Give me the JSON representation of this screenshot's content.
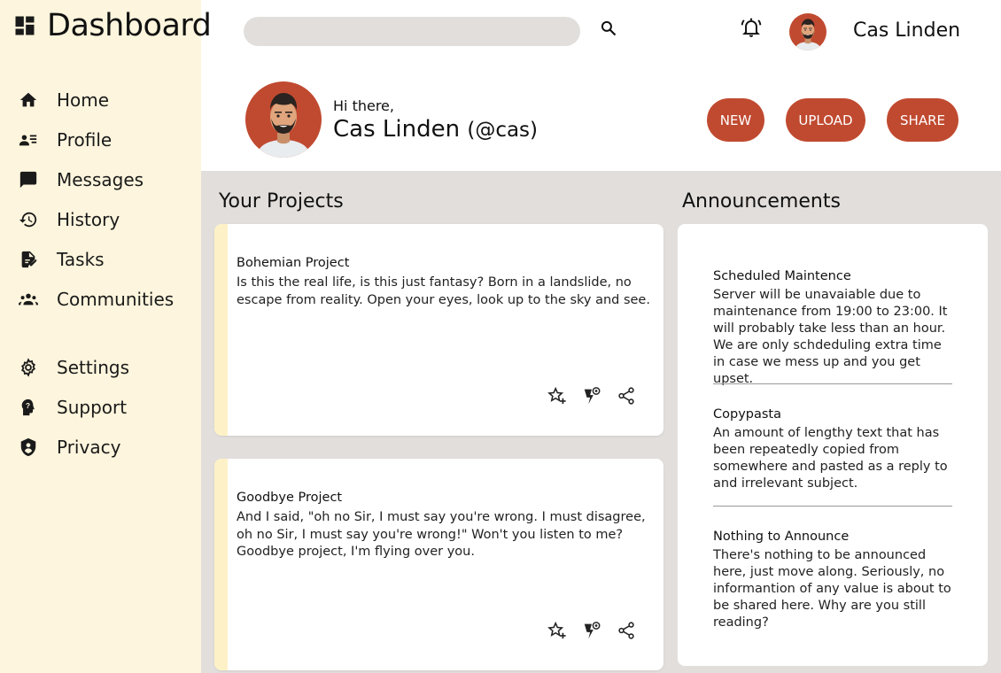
{
  "sidebar": {
    "brand": "Dashboard",
    "nav_primary": [
      {
        "label": "Home",
        "icon": "home-icon"
      },
      {
        "label": "Profile",
        "icon": "profile-icon"
      },
      {
        "label": "Messages",
        "icon": "messages-icon"
      },
      {
        "label": "History",
        "icon": "history-icon"
      },
      {
        "label": "Tasks",
        "icon": "tasks-icon"
      },
      {
        "label": "Communities",
        "icon": "communities-icon"
      }
    ],
    "nav_secondary": [
      {
        "label": "Settings",
        "icon": "settings-icon"
      },
      {
        "label": "Support",
        "icon": "support-icon"
      },
      {
        "label": "Privacy",
        "icon": "privacy-icon"
      }
    ]
  },
  "topbar": {
    "search_value": "",
    "username": "Cas Linden"
  },
  "header": {
    "greeting": "Hi there,",
    "name": "Cas Linden",
    "handle": "(@cas)",
    "buttons": {
      "new": "NEW",
      "upload": "UPLOAD",
      "share": "SHARE"
    }
  },
  "projects": {
    "title": "Your Projects",
    "items": [
      {
        "title": "Bohemian Project",
        "description": "Is this the real life, is this just fantasy? Born in a landslide, no escape from reality. Open your eyes, look up to the sky and see."
      },
      {
        "title": "Goodbye Project",
        "description": "And I said, \"oh no Sir, I must say you're wrong. I must disagree, oh no Sir, I must say you're wrong!\" Won't you listen to me? Goodbye project, I'm flying over you."
      }
    ]
  },
  "announcements": {
    "title": "Announcements",
    "items": [
      {
        "title": "Scheduled Maintence",
        "body": "Server will be unavaiable due to maintenance from 19:00 to 23:00. It will probably take less than an hour. We are only schdeduling extra time in case we mess up and you get upset."
      },
      {
        "title": "Copypasta",
        "body": "An amount of lengthy text that has been repeatedly copied from somewhere and pasted as a reply to and irrelevant subject."
      },
      {
        "title": "Nothing to Announce",
        "body": "There's nothing to be announced here, just move along. Seriously, no informantion of any value is about to be shared here. Why are you still reading?"
      }
    ]
  },
  "colors": {
    "sidebar_bg": "#fdf5dd",
    "accent": "#c04a30",
    "content_bg": "#e2dedb",
    "card_accent": "#fdf2c7"
  }
}
